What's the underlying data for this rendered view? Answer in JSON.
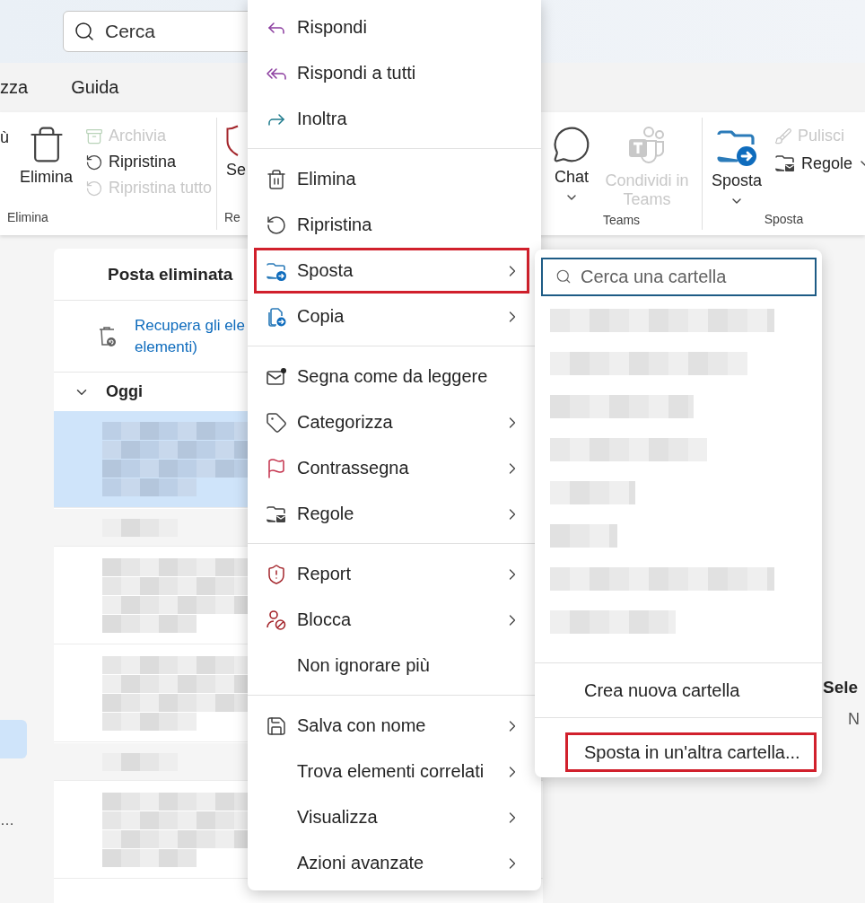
{
  "search": {
    "placeholder": "Cerca"
  },
  "tabs": [
    {
      "label": "zza"
    },
    {
      "label": "Guida"
    }
  ],
  "ribbon": {
    "groups": [
      {
        "label": "Elimina",
        "items": [
          {
            "kind": "fragment",
            "label": "ù"
          },
          {
            "kind": "large",
            "label": "Elimina",
            "disabled": false,
            "dropdown": false
          },
          {
            "kind": "stack",
            "items": [
              {
                "label": "Archivia",
                "disabled": true,
                "dropdown": false
              },
              {
                "label": "Ripristina",
                "disabled": false,
                "dropdown": false
              },
              {
                "label": "Ripristina tutto",
                "disabled": true,
                "dropdown": false
              }
            ]
          }
        ]
      },
      {
        "label": "Re",
        "items": [
          {
            "kind": "large",
            "label": "Se",
            "disabled": false,
            "dropdown": false
          }
        ]
      },
      {
        "label": "Teams",
        "items": [
          {
            "kind": "large",
            "label": "Chat",
            "disabled": false,
            "dropdown": true
          },
          {
            "kind": "large",
            "label": "Condividi in Teams",
            "disabled": true,
            "dropdown": false
          }
        ]
      },
      {
        "label": "Sposta",
        "items": [
          {
            "kind": "large",
            "label": "Sposta",
            "disabled": false,
            "dropdown": true
          },
          {
            "kind": "stack",
            "items": [
              {
                "label": "Pulisci",
                "disabled": true,
                "dropdown": false
              },
              {
                "label": "Regole",
                "disabled": false,
                "dropdown": true
              }
            ]
          }
        ]
      }
    ]
  },
  "sidebar": {
    "items": [
      {
        "selected": true
      }
    ],
    "more": "…"
  },
  "mail_list": {
    "title": "Posta eliminata",
    "recover_lines": [
      "Recupera gli ele",
      "elementi)"
    ],
    "group_label": "Oggi",
    "group_expanded": true,
    "rows": [
      {
        "kind": "message",
        "selected": true
      },
      {
        "kind": "group",
        "selected": false
      },
      {
        "kind": "message",
        "selected": false
      },
      {
        "kind": "message",
        "selected": false
      },
      {
        "kind": "group",
        "selected": false
      },
      {
        "kind": "message",
        "selected": false
      }
    ]
  },
  "reading_pane": {
    "title": "Sele",
    "subtitle": "N"
  },
  "context_menu": {
    "sections": [
      [
        {
          "label": "Rispondi",
          "submenu": false,
          "marked": false
        },
        {
          "label": "Rispondi a tutti",
          "submenu": false,
          "marked": false
        },
        {
          "label": "Inoltra",
          "submenu": false,
          "marked": false
        }
      ],
      [
        {
          "label": "Elimina",
          "submenu": false,
          "marked": false
        },
        {
          "label": "Ripristina",
          "submenu": false,
          "marked": false
        },
        {
          "label": "Sposta",
          "submenu": true,
          "marked": true
        },
        {
          "label": "Copia",
          "submenu": true,
          "marked": false
        }
      ],
      [
        {
          "label": "Segna come da leggere",
          "submenu": false,
          "marked": false
        },
        {
          "label": "Categorizza",
          "submenu": true,
          "marked": false
        },
        {
          "label": "Contrassegna",
          "submenu": true,
          "marked": false
        },
        {
          "label": "Regole",
          "submenu": true,
          "marked": false
        }
      ],
      [
        {
          "label": "Report",
          "submenu": true,
          "marked": false
        },
        {
          "label": "Blocca",
          "submenu": true,
          "marked": false
        },
        {
          "label": "Non ignorare più",
          "submenu": false,
          "marked": false
        }
      ],
      [
        {
          "label": "Salva con nome",
          "submenu": true,
          "marked": false
        },
        {
          "label": "Trova elementi correlati",
          "submenu": true,
          "marked": false
        },
        {
          "label": "Visualizza",
          "submenu": true,
          "marked": false
        },
        {
          "label": "Azioni avanzate",
          "submenu": true,
          "marked": false
        }
      ]
    ]
  },
  "submenu": {
    "search_placeholder": "Cerca una cartella",
    "actions": [
      {
        "label": "Crea nuova cartella",
        "marked": false
      },
      {
        "label": "Sposta in un'altra cartella...",
        "marked": true
      }
    ]
  }
}
